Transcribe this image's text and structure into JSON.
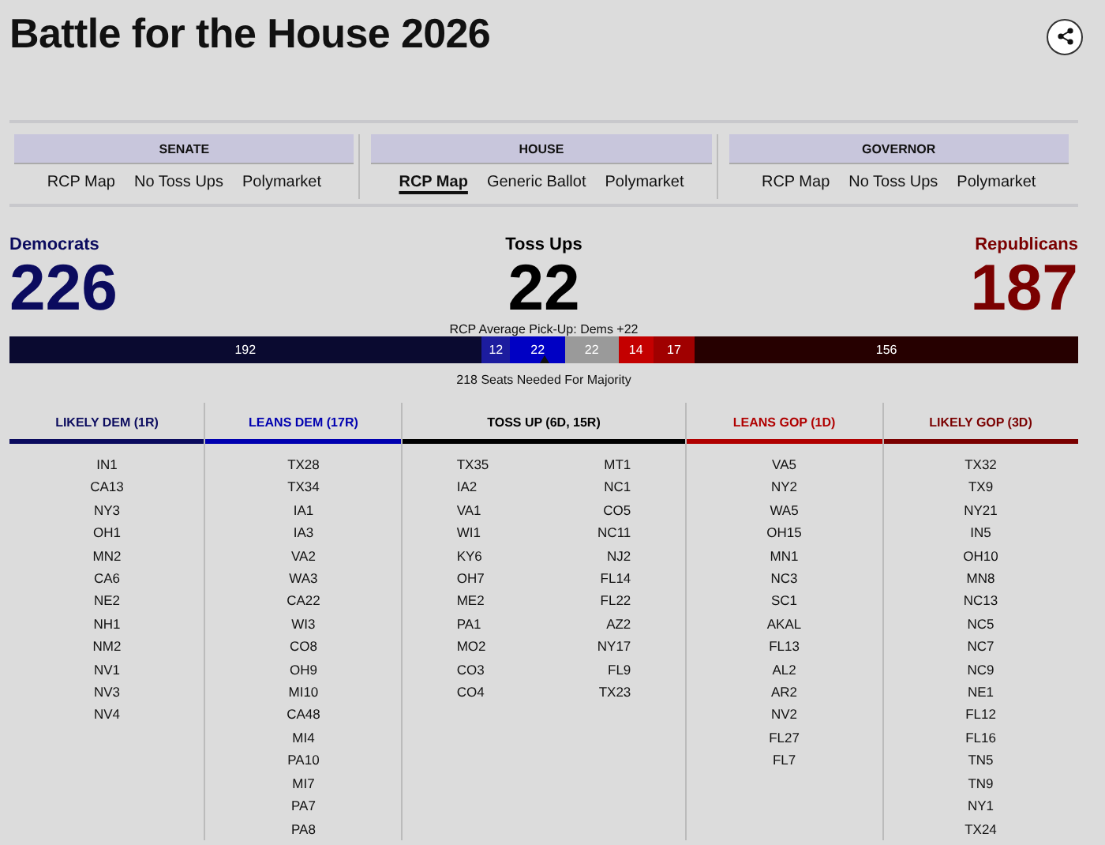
{
  "title": "Battle for the House 2026",
  "nav": [
    {
      "heading": "SENATE",
      "links": [
        {
          "label": "RCP Map",
          "selected": false
        },
        {
          "label": "No Toss Ups",
          "selected": false
        },
        {
          "label": "Polymarket",
          "selected": false
        }
      ]
    },
    {
      "heading": "HOUSE",
      "links": [
        {
          "label": "RCP Map",
          "selected": true
        },
        {
          "label": "Generic Ballot",
          "selected": false
        },
        {
          "label": "Polymarket",
          "selected": false
        }
      ]
    },
    {
      "heading": "GOVERNOR",
      "links": [
        {
          "label": "RCP Map",
          "selected": false
        },
        {
          "label": "No Toss Ups",
          "selected": false
        },
        {
          "label": "Polymarket",
          "selected": false
        }
      ]
    }
  ],
  "summary": [
    {
      "label": "Democrats",
      "count": "226",
      "color": "#0b0b5e"
    },
    {
      "label": "Toss Ups",
      "count": "22",
      "color": "#000000"
    },
    {
      "label": "Republicans",
      "count": "187",
      "color": "#7a0000"
    }
  ],
  "pickup": "RCP Average Pick-Up: Dems +22",
  "bar": [
    {
      "label": "192",
      "color": "#0a0a30"
    },
    {
      "label": "12",
      "color": "#1c1c9e"
    },
    {
      "label": "22",
      "color": "#0000c4"
    },
    {
      "label": "22",
      "color": "#9a9a9a"
    },
    {
      "label": "14",
      "color": "#c40000"
    },
    {
      "label": "17",
      "color": "#a00000"
    },
    {
      "label": "156",
      "color": "#260000"
    }
  ],
  "majority": "218 Seats Needed For Majority",
  "columns": [
    {
      "heading": "LIKELY DEM (1R)",
      "color": "#0b0b5e",
      "lists": [
        [
          "IN1",
          "CA13",
          "NY3",
          "OH1",
          "MN2",
          "CA6",
          "NE2",
          "NH1",
          "NM2",
          "NV1",
          "NV3",
          "NV4"
        ]
      ]
    },
    {
      "heading": "LEANS DEM (17R)",
      "color": "#0000b0",
      "lists": [
        [
          "TX28",
          "TX34",
          "IA1",
          "IA3",
          "VA2",
          "WA3",
          "CA22",
          "WI3",
          "CO8",
          "OH9",
          "MI10",
          "CA48",
          "MI4",
          "PA10",
          "MI7",
          "PA7",
          "PA8"
        ]
      ]
    },
    {
      "heading": "TOSS UP (6D, 15R)",
      "color": "#000000",
      "lists": [
        [
          "TX35",
          "IA2",
          "VA1",
          "WI1",
          "KY6",
          "OH7",
          "ME2",
          "PA1",
          "MO2",
          "CO3",
          "CO4"
        ],
        [
          "MT1",
          "NC1",
          "CO5",
          "NC11",
          "NJ2",
          "FL14",
          "FL22",
          "AZ2",
          "NY17",
          "FL9",
          "TX23"
        ]
      ]
    },
    {
      "heading": "LEANS GOP (1D)",
      "color": "#b00000",
      "lists": [
        [
          "VA5",
          "NY2",
          "WA5",
          "OH15",
          "MN1",
          "NC3",
          "SC1",
          "AKAL",
          "FL13",
          "AL2",
          "AR2",
          "NV2",
          "FL27",
          "FL7"
        ]
      ]
    },
    {
      "heading": "LIKELY GOP (3D)",
      "color": "#7a0000",
      "lists": [
        [
          "TX32",
          "TX9",
          "NY21",
          "IN5",
          "OH10",
          "MN8",
          "NC13",
          "NC5",
          "NC7",
          "NC9",
          "NE1",
          "FL12",
          "FL16",
          "TN5",
          "TN9",
          "NY1",
          "TX24"
        ]
      ]
    }
  ]
}
